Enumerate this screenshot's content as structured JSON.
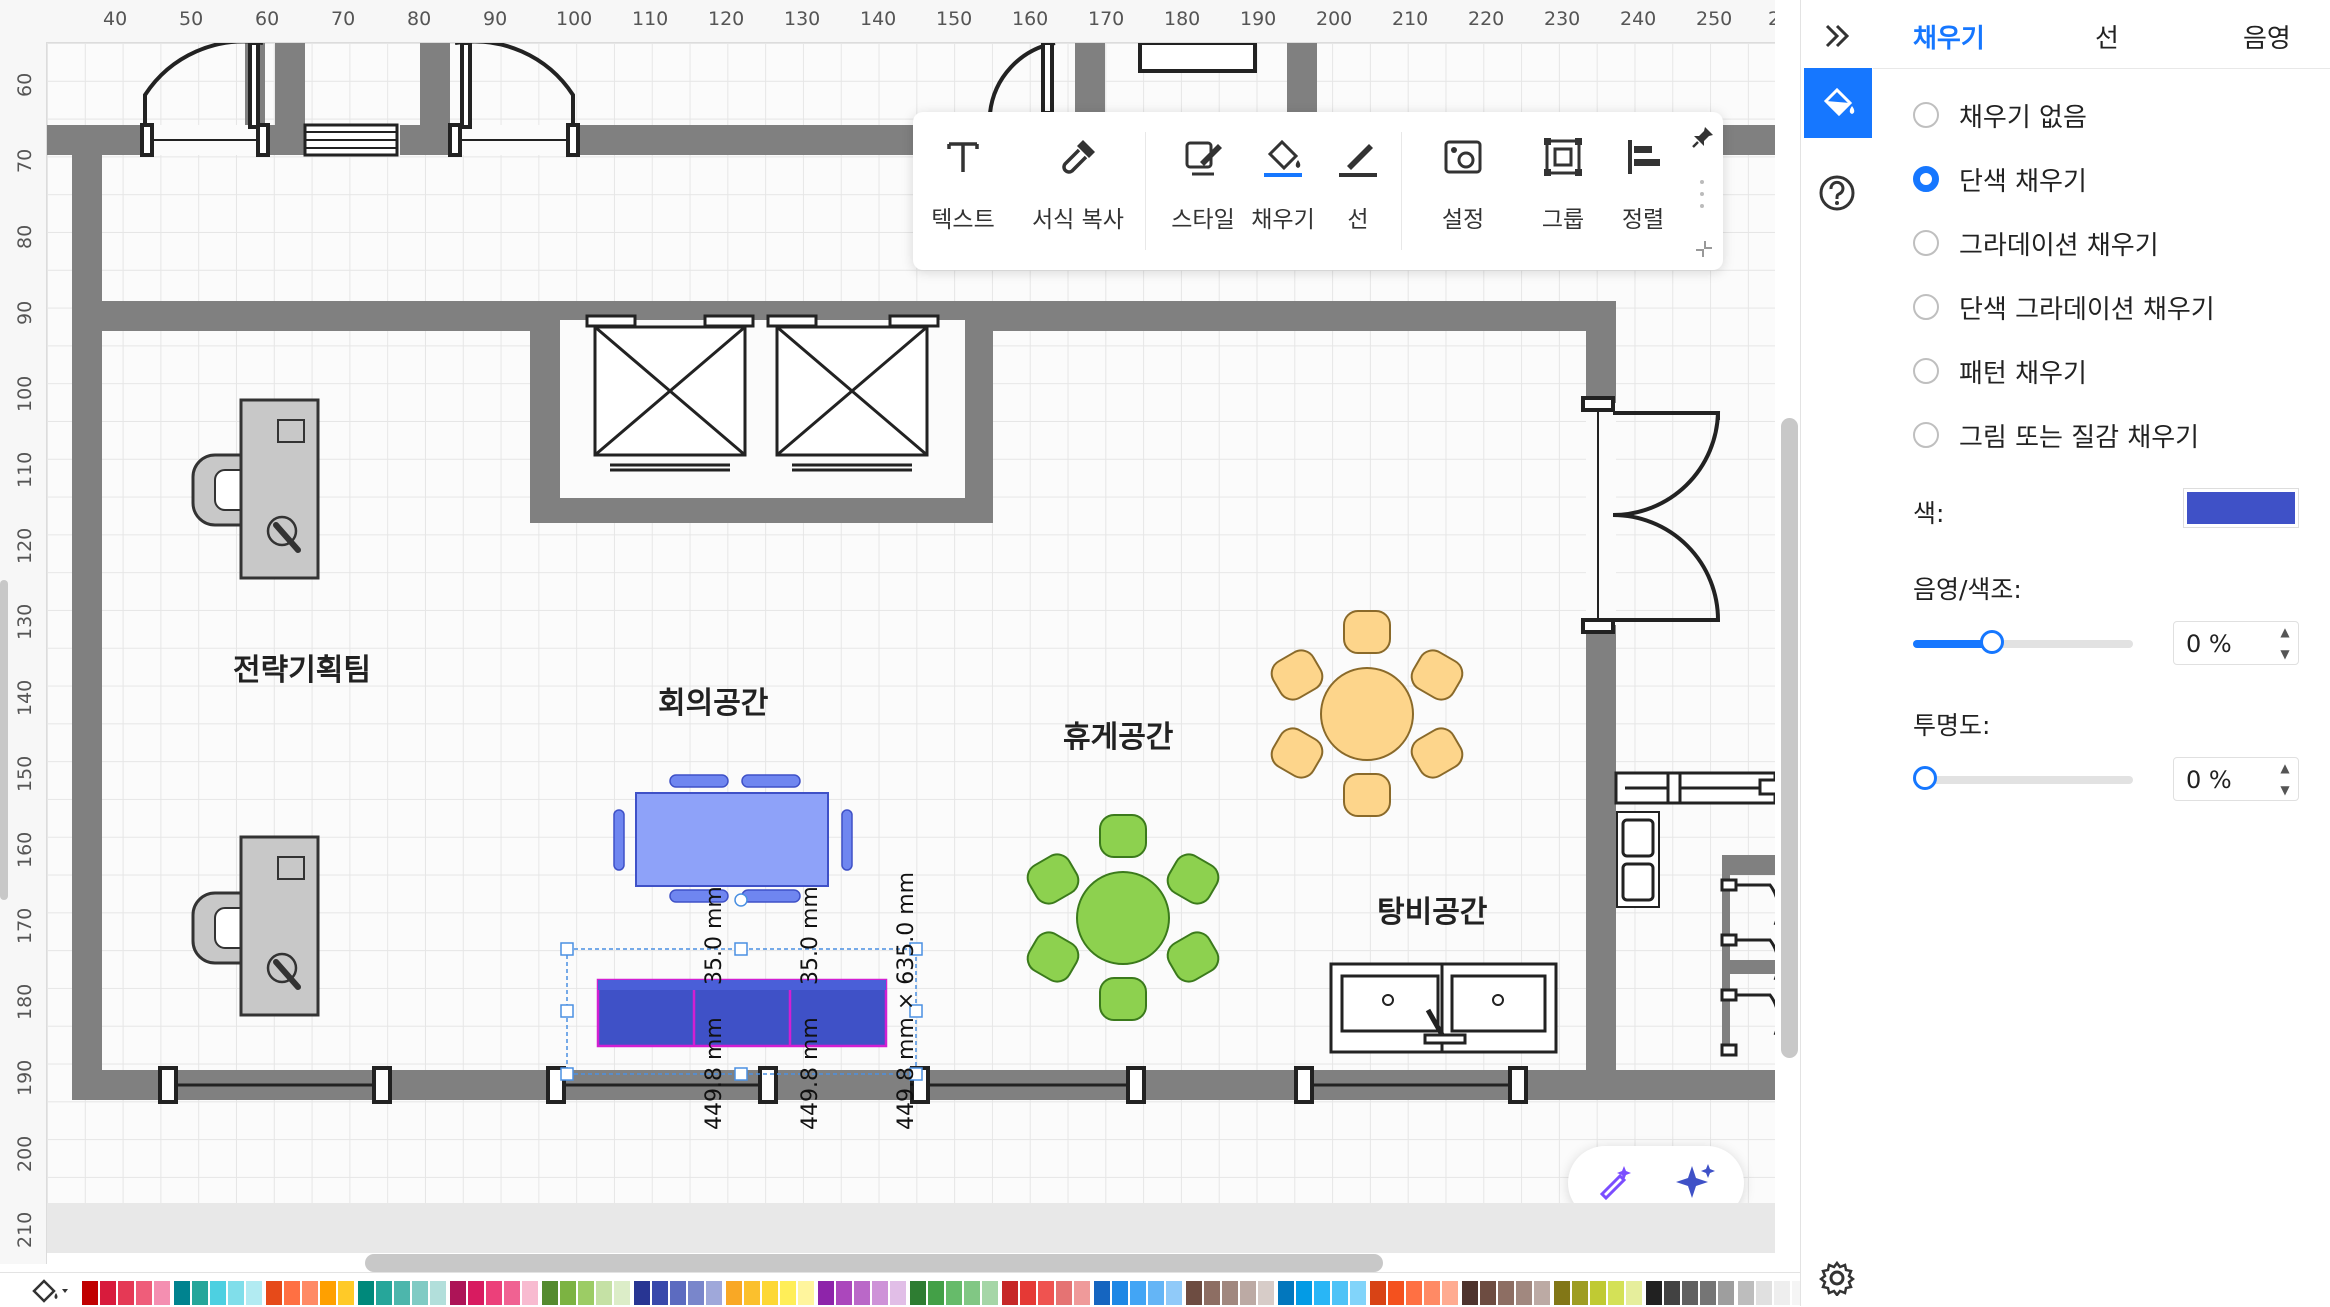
{
  "ruler": {
    "top_ticks": [
      "40",
      "50",
      "60",
      "70",
      "80",
      "90",
      "100",
      "110",
      "120",
      "130",
      "140",
      "150",
      "160",
      "170",
      "180",
      "190",
      "200",
      "210",
      "220",
      "230",
      "240",
      "250",
      "2"
    ],
    "left_ticks": [
      "60",
      "70",
      "80",
      "90",
      "100",
      "110",
      "120",
      "130",
      "140",
      "150",
      "160",
      "170",
      "180",
      "190",
      "200",
      "210"
    ]
  },
  "floorplan": {
    "rooms": {
      "strategy": "전략기획팀",
      "meeting": "회의공간",
      "lounge": "휴게공간",
      "pantry": "탕비공간"
    },
    "dimensions": {
      "h1": "35.0 mm",
      "h2": "35.0 mm",
      "w1": "449.8 mm",
      "w2": "449.8 mm",
      "w3": "449.8 mm × 635.0 mm"
    }
  },
  "toolbar": {
    "items": [
      {
        "label": "텍스트",
        "icon": "text-icon"
      },
      {
        "label": "서식 복사",
        "icon": "format-painter-icon"
      },
      {
        "label": "스타일",
        "icon": "style-icon"
      },
      {
        "label": "채우기",
        "icon": "fill-bucket-icon"
      },
      {
        "label": "선",
        "icon": "line-pen-icon"
      },
      {
        "label": "설정",
        "icon": "settings-image-icon"
      },
      {
        "label": "그룹",
        "icon": "group-icon"
      },
      {
        "label": "정렬",
        "icon": "align-icon"
      }
    ]
  },
  "panel": {
    "tabs": [
      "채우기",
      "선",
      "음영"
    ],
    "active_tab": "채우기",
    "fill_options": [
      "채우기 없음",
      "단색 채우기",
      "그라데이션 채우기",
      "단색 그라데이션 채우기",
      "패턴 채우기",
      "그림 또는 질감 채우기"
    ],
    "selected_option": "단색 채우기",
    "color_label": "색:",
    "color_value": "#3f51c7",
    "shade_label": "음영/색조:",
    "shade_value": "0 %",
    "shade_fraction": 0.34,
    "opacity_label": "투명도:",
    "opacity_value": "0 %",
    "opacity_fraction": 0.0
  },
  "colors": {
    "accent": "#1677ff",
    "wall": "#808080",
    "desk_fill": "#c8c8c8",
    "meeting_table": "#8ea2f9",
    "meeting_chair": "#6f86f0",
    "lounge_green": "#8dd14f",
    "lounge_orange": "#fdd58b",
    "selected_fill": "#3f51c7",
    "selection_magenta": "#d21fd2"
  },
  "palette": [
    "#c00000",
    "#d81b3c",
    "#e53955",
    "#ef5d7a",
    "#f48fb1",
    "#00838f",
    "#26a69a",
    "#4dd0e1",
    "#80deea",
    "#b2ebf2",
    "#e64a19",
    "#ff7043",
    "#ff8a65",
    "#ffa000",
    "#ffca28",
    "#00897b",
    "#26a69a",
    "#4db6ac",
    "#80cbc4",
    "#b2dfdb",
    "#ad1457",
    "#d81b60",
    "#ec407a",
    "#f06292",
    "#f8bbd0",
    "#558b2f",
    "#7cb342",
    "#9ccc65",
    "#c5e1a5",
    "#dcedc8",
    "#283593",
    "#3949ab",
    "#5c6bc0",
    "#7986cb",
    "#9fa8da",
    "#f9a825",
    "#fbc02d",
    "#fdd835",
    "#ffee58",
    "#fff59d",
    "#8e24aa",
    "#ab47bc",
    "#ba68c8",
    "#ce93d8",
    "#e1bee7",
    "#2e7d32",
    "#43a047",
    "#66bb6a",
    "#81c784",
    "#a5d6a7",
    "#c62828",
    "#e53935",
    "#ef5350",
    "#e57373",
    "#ef9a9a",
    "#1565c0",
    "#1e88e5",
    "#42a5f5",
    "#64b5f6",
    "#90caf9",
    "#6d4c41",
    "#8d6e63",
    "#a1887f",
    "#bcaaa4",
    "#d7ccc8",
    "#0277bd",
    "#039be5",
    "#29b6f6",
    "#4fc3f7",
    "#81d4fa",
    "#d84315",
    "#f4511e",
    "#ff7043",
    "#ff8a65",
    "#ffab91",
    "#4e342e",
    "#6d4c41",
    "#8d6e63",
    "#a1887f",
    "#bcaaa4",
    "#827717",
    "#9e9d24",
    "#c0ca33",
    "#d4e157",
    "#e6ee9c",
    "#212121",
    "#424242",
    "#616161",
    "#757575",
    "#9e9e9e",
    "#bdbdbd",
    "#e0e0e0",
    "#eeeeee",
    "#f5f5f5",
    "#fafafa"
  ]
}
